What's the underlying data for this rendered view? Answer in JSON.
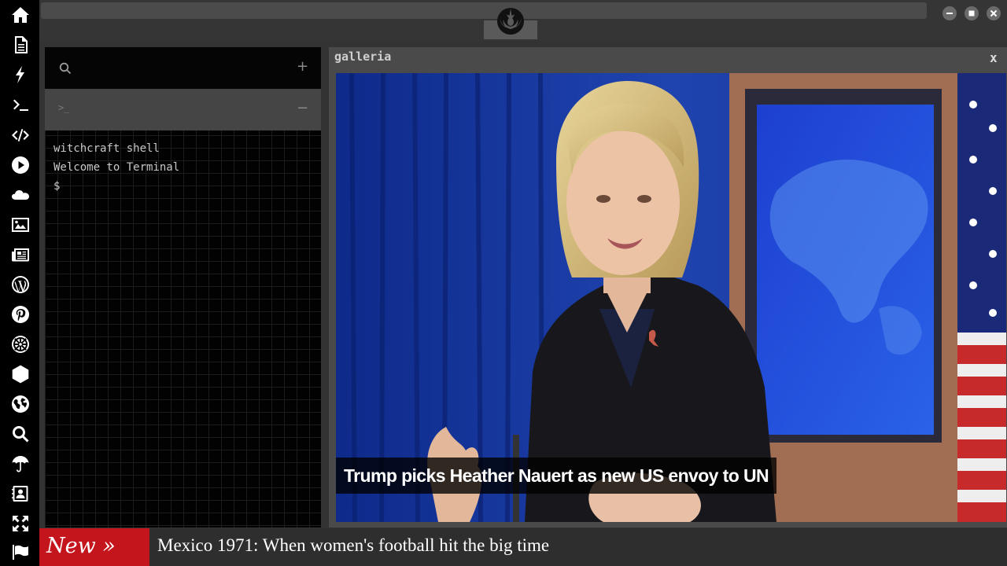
{
  "sidebar": {
    "items": [
      {
        "name": "home-icon"
      },
      {
        "name": "document-icon"
      },
      {
        "name": "lightning-icon"
      },
      {
        "name": "terminal-icon"
      },
      {
        "name": "code-icon"
      },
      {
        "name": "play-icon"
      },
      {
        "name": "cloud-icon"
      },
      {
        "name": "image-icon"
      },
      {
        "name": "newspaper-icon"
      },
      {
        "name": "wordpress-icon"
      },
      {
        "name": "pinterest-icon"
      },
      {
        "name": "empire-icon"
      },
      {
        "name": "network-icon"
      },
      {
        "name": "globe-icon"
      },
      {
        "name": "search-icon"
      },
      {
        "name": "umbrella-icon"
      },
      {
        "name": "contact-book-icon"
      },
      {
        "name": "expand-icon"
      },
      {
        "name": "flag-icon"
      }
    ]
  },
  "topbar": {
    "logo": "rebel-alliance-logo"
  },
  "terminal": {
    "search_icon": "search-icon",
    "add_label": "+",
    "tab_prompt": ">_",
    "collapse_label": "−",
    "lines": [
      "witchcraft shell",
      "Welcome to Terminal",
      "$"
    ]
  },
  "gallery": {
    "title": "galleria",
    "close_label": "x",
    "caption": "Trump picks Heather Nauert as new US envoy to UN"
  },
  "ticker": {
    "badge": "New »",
    "headline": "Mexico 1971: When women's football hit the big time"
  },
  "colors": {
    "sidebar_bg": "#000000",
    "app_bg": "#333333",
    "ticker_badge": "#c4151c",
    "terminal_bg": "#020202"
  }
}
